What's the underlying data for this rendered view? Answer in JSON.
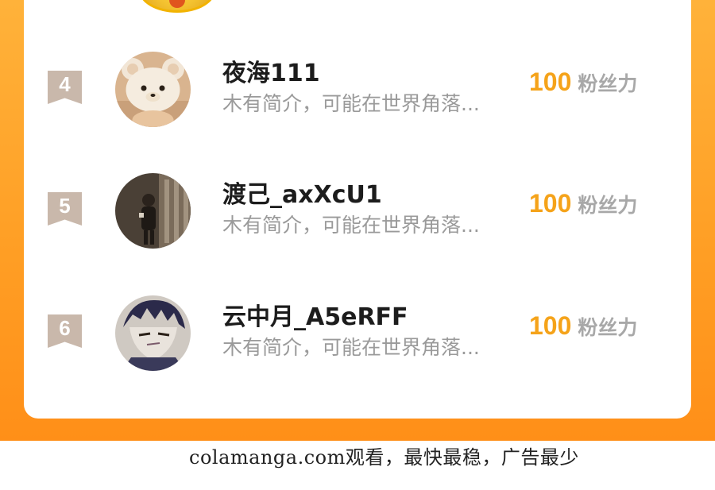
{
  "ranking": {
    "rows": [
      {
        "rank": "4",
        "name": "夜海111",
        "bio": "木有简介，可能在世界角落...",
        "score": "100",
        "unit": "粉丝力",
        "avatar_icon": "bear-hat-avatar-icon"
      },
      {
        "rank": "5",
        "name": "渡己_axXcU1",
        "bio": "木有简介，可能在世界角落...",
        "score": "100",
        "unit": "粉丝力",
        "avatar_icon": "dark-photo-avatar-icon"
      },
      {
        "rank": "6",
        "name": "云中月_A5eRFF",
        "bio": "木有简介，可能在世界角落...",
        "score": "100",
        "unit": "粉丝力",
        "avatar_icon": "anime-boy-avatar-icon"
      }
    ]
  },
  "footer": {
    "text": "colamanga.com观看，最快最稳，广告最少"
  },
  "colors": {
    "accent_orange": "#ff9f25",
    "score_orange": "#f5a31a",
    "rank_badge": "#c9b8ab"
  }
}
